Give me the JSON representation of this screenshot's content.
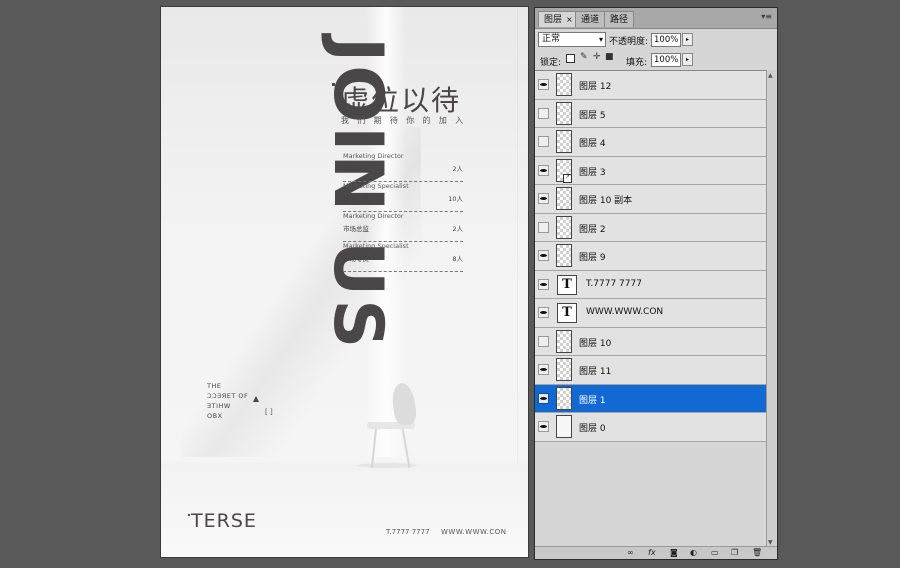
{
  "document": {
    "vertical_title": "JOIN US",
    "title_cn": "虚位以待",
    "subtitle_cn": "我们期待你的加入",
    "jobs": [
      {
        "en": "Marketing Director",
        "cn": "市场总监",
        "count": "2人"
      },
      {
        "en": "Marketing Specialist",
        "cn": "市场专员",
        "count": "10人"
      },
      {
        "en": "Marketing Director",
        "cn": "市场总监",
        "count": "2人"
      },
      {
        "en": "Marketing Specialist",
        "cn": "市场专员",
        "count": "8人"
      }
    ],
    "side_text": [
      "THE",
      "ƆƆƎЯET OF",
      "ƎTIHW",
      "OBX"
    ],
    "bracket": "[ ]",
    "brand": "TERSE",
    "phone": "T.7777 7777",
    "website": "WWW.WWW.CON"
  },
  "layers_panel": {
    "tabs": [
      {
        "label": "图层",
        "active": true
      },
      {
        "label": "通道",
        "active": false
      },
      {
        "label": "路径",
        "active": false
      }
    ],
    "close_glyph": "×",
    "menu_glyph": "▾≡",
    "blend_mode": "正常",
    "opacity_label": "不透明度:",
    "opacity_value": "100%",
    "lock_label": "锁定:",
    "fill_label": "填充:",
    "fill_value": "100%",
    "layers": [
      {
        "name": "图层 12",
        "visible": true,
        "thumb": "checker",
        "selected": false
      },
      {
        "name": "图层 5",
        "visible": false,
        "thumb": "checker",
        "selected": false
      },
      {
        "name": "图层 4",
        "visible": false,
        "thumb": "checker",
        "selected": false
      },
      {
        "name": "图层 3",
        "visible": true,
        "thumb": "checker-link",
        "selected": false
      },
      {
        "name": "图层 10 副本",
        "visible": true,
        "thumb": "checker",
        "selected": false
      },
      {
        "name": "图层 2",
        "visible": false,
        "thumb": "checker",
        "selected": false
      },
      {
        "name": "图层 9",
        "visible": true,
        "thumb": "checker",
        "selected": false
      },
      {
        "name": "T.7777 7777",
        "visible": true,
        "thumb": "text",
        "selected": false
      },
      {
        "name": "WWW.WWW.CON",
        "visible": true,
        "thumb": "text",
        "selected": false
      },
      {
        "name": "图层 10",
        "visible": false,
        "thumb": "checker",
        "selected": false
      },
      {
        "name": "图层 11",
        "visible": true,
        "thumb": "checker",
        "selected": false
      },
      {
        "name": "图层 1",
        "visible": true,
        "thumb": "checker",
        "selected": true
      },
      {
        "name": "图层 0",
        "visible": true,
        "thumb": "white",
        "selected": false
      }
    ],
    "bottom_icons": [
      "link-icon",
      "fx-icon",
      "mask-icon",
      "adjustment-icon",
      "folder-icon",
      "new-layer-icon",
      "trash-icon"
    ]
  },
  "colors": {
    "accent_selected": "#1269d3",
    "title_text": "#4b4647",
    "workspace": "#595959"
  }
}
